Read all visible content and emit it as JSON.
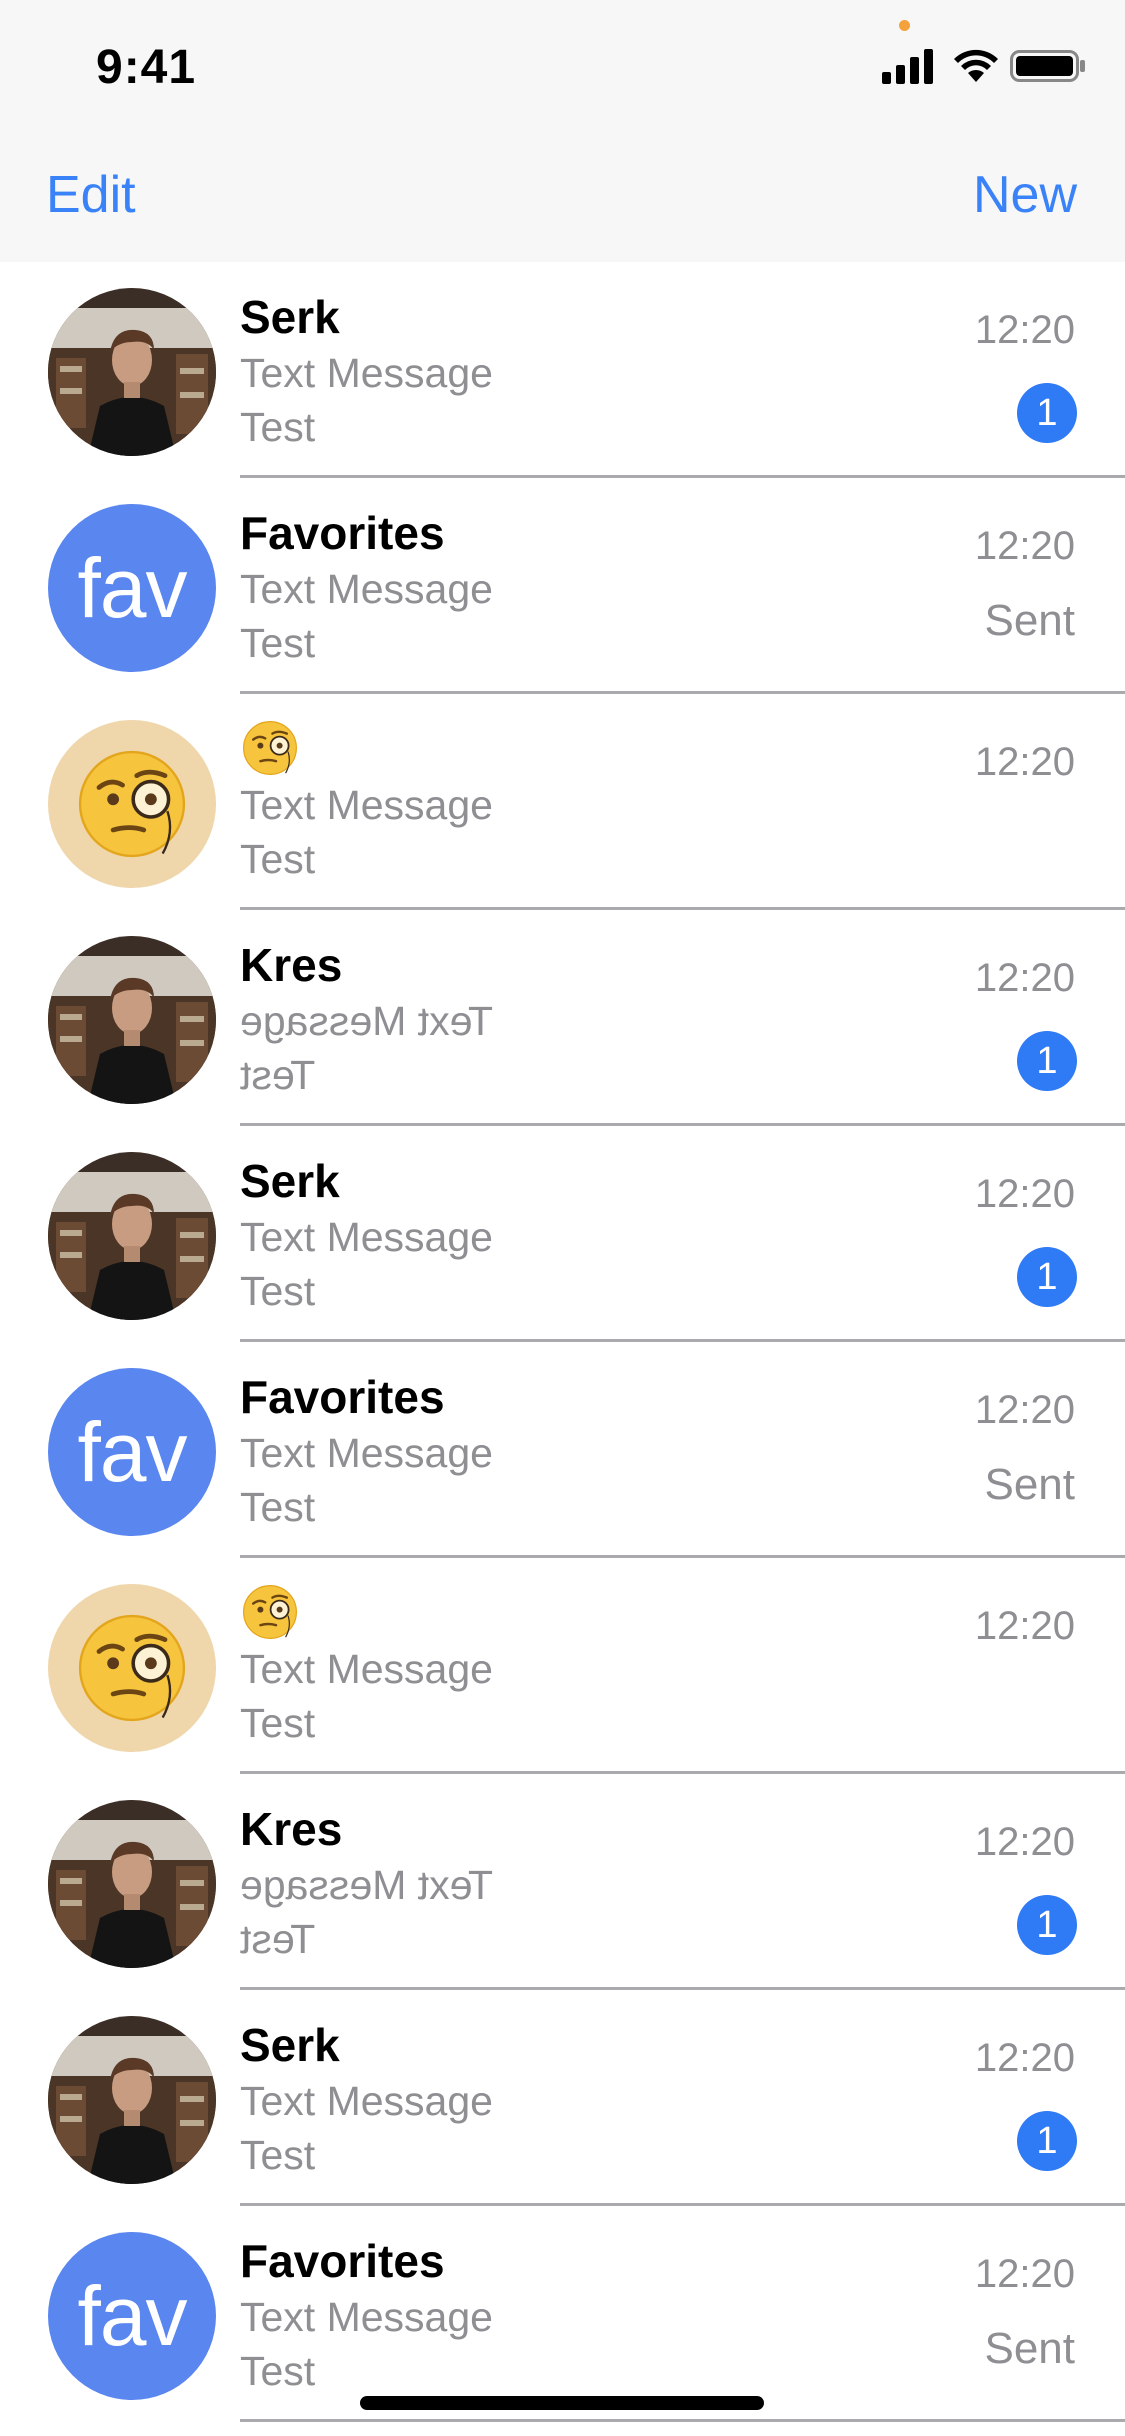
{
  "status_bar": {
    "time": "9:41"
  },
  "nav": {
    "edit_label": "Edit",
    "new_label": "New"
  },
  "conversations": [
    {
      "avatar": "photo",
      "name": "Serk",
      "line1": "Text Message",
      "line2": "Test",
      "time": "12:20",
      "badge": "1",
      "sent": "",
      "mirrored": false
    },
    {
      "avatar": "fav",
      "avatar_text": "fav",
      "name": "Favorites",
      "line1": "Text Message",
      "line2": "Test",
      "time": "12:20",
      "badge": "",
      "sent": "Sent",
      "mirrored": false
    },
    {
      "avatar": "emoji",
      "name": "",
      "name_icon": "monocle-face-icon",
      "line1": "Text Message",
      "line2": "Test",
      "time": "12:20",
      "badge": "",
      "sent": "",
      "mirrored": false
    },
    {
      "avatar": "photo",
      "name": "Kres",
      "line1": "Text Message",
      "line2": "Test",
      "time": "12:20",
      "badge": "1",
      "sent": "",
      "mirrored": true
    },
    {
      "avatar": "photo",
      "name": "Serk",
      "line1": "Text Message",
      "line2": "Test",
      "time": "12:20",
      "badge": "1",
      "sent": "",
      "mirrored": false
    },
    {
      "avatar": "fav",
      "avatar_text": "fav",
      "name": "Favorites",
      "line1": "Text Message",
      "line2": "Test",
      "time": "12:20",
      "badge": "",
      "sent": "Sent",
      "mirrored": false
    },
    {
      "avatar": "emoji",
      "name": "",
      "name_icon": "monocle-face-icon",
      "line1": "Text Message",
      "line2": "Test",
      "time": "12:20",
      "badge": "",
      "sent": "",
      "mirrored": false
    },
    {
      "avatar": "photo",
      "name": "Kres",
      "line1": "Text Message",
      "line2": "Test",
      "time": "12:20",
      "badge": "1",
      "sent": "",
      "mirrored": true
    },
    {
      "avatar": "photo",
      "name": "Serk",
      "line1": "Text Message",
      "line2": "Test",
      "time": "12:20",
      "badge": "1",
      "sent": "",
      "mirrored": false
    },
    {
      "avatar": "fav",
      "avatar_text": "fav",
      "name": "Favorites",
      "line1": "Text Message",
      "line2": "Test",
      "time": "12:20",
      "badge": "",
      "sent": "Sent",
      "mirrored": false
    }
  ],
  "colors": {
    "accent": "#3a82f7",
    "badge": "#2f7af5",
    "fav_avatar": "#5a86f0",
    "emoji_avatar": "#efd6ab"
  }
}
